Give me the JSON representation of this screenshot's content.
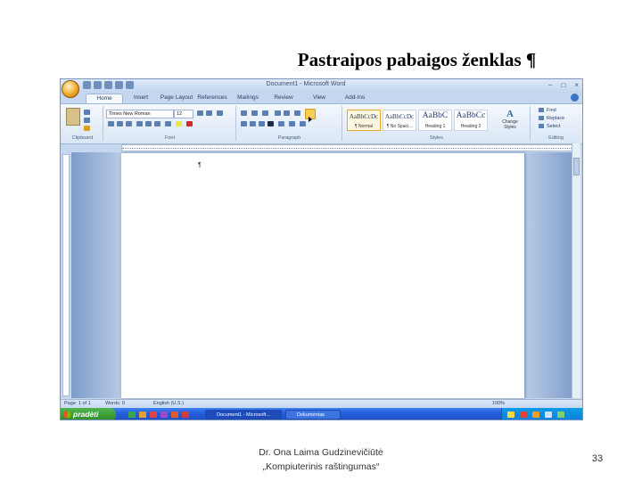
{
  "slide": {
    "title": "Pastraipos pabaigos ženklas ¶",
    "author_line1": "Dr. Ona Laima Gudzinevičiūtė",
    "author_line2": "„Kompiuterinis raštingumas“",
    "page_number": "33"
  },
  "word": {
    "window_title": "Document1 - Microsoft Word",
    "tabs": [
      "Home",
      "Insert",
      "Page Layout",
      "References",
      "Mailings",
      "Review",
      "View",
      "Add-Ins"
    ],
    "active_tab": "Home",
    "font_name": "Times New Roman",
    "font_size": "12",
    "group_labels": {
      "clipboard": "Clipboard",
      "font": "Font",
      "paragraph": "Paragraph",
      "styles": "Styles",
      "editing": "Editing"
    },
    "styles": [
      {
        "sample": "AaBbCcDc",
        "name": "¶ Normal"
      },
      {
        "sample": "AaBbCcDc",
        "name": "¶ No Spaci..."
      },
      {
        "sample": "AaBbC",
        "name": "Heading 1"
      },
      {
        "sample": "AaBbCc",
        "name": "Heading 2"
      }
    ],
    "change_styles": "Change Styles",
    "editing": [
      "Find",
      "Replace",
      "Select"
    ],
    "status": {
      "page": "Page: 1 of 1",
      "words": "Words: 0",
      "language": "English (U.S.)",
      "zoom": "100%"
    },
    "pilcrow": "¶"
  },
  "taskbar": {
    "start": "pradėti",
    "task1": "Document1 - Microsoft...",
    "task2": "Dokumentas"
  }
}
